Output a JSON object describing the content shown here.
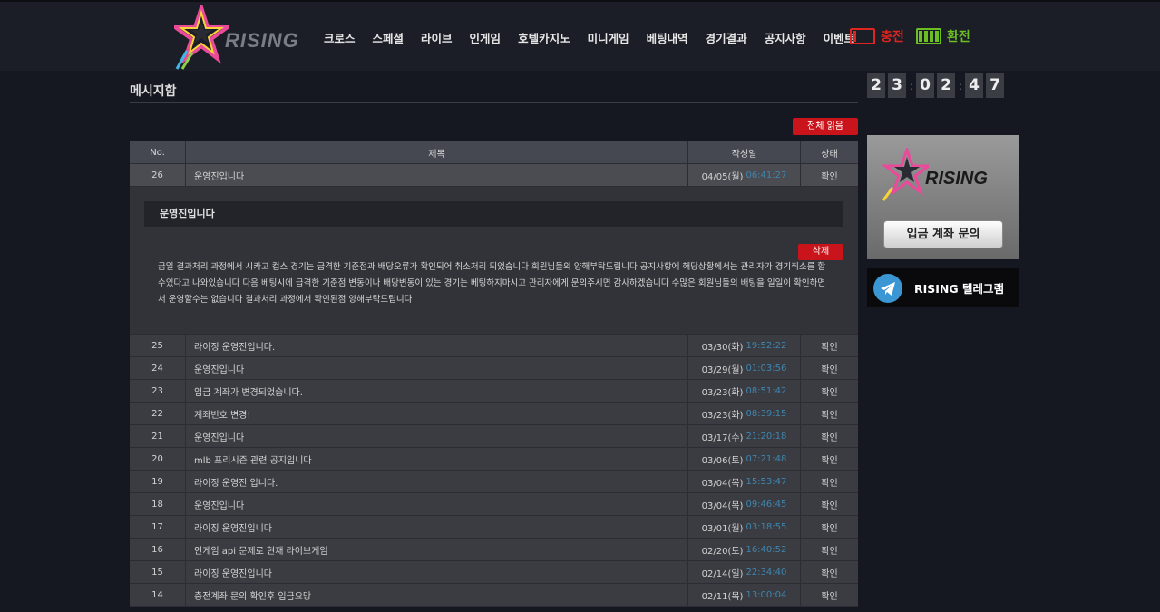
{
  "header": {
    "logo_text": "RISING",
    "nav": [
      "크로스",
      "스페셜",
      "라이브",
      "인게임",
      "호텔카지노",
      "미니게임",
      "베팅내역",
      "경기결과",
      "공지사항",
      "이벤트"
    ],
    "charge_label": "충전",
    "exchange_label": "환전",
    "colors": {
      "charge": "#e0241f",
      "exchange": "#6cbf22"
    }
  },
  "page": {
    "title": "메시지함",
    "read_all_label": "전체 읽음"
  },
  "table": {
    "headers": {
      "no": "No.",
      "title": "제목",
      "date": "작성일",
      "state": "상태"
    },
    "opened": {
      "no": "26",
      "title": "운영진입니다",
      "date": "04/05(월)",
      "time": "06:41:27",
      "state": "확인",
      "detail_title": "운영진입니다",
      "delete_label": "삭제",
      "body": "금일 결과처리 과정에서 시카고 컵스 경기는 급격한 기준점과 배당오류가 확인되어 취소처리 되었습니다 회원님들의 양해부탁드립니다 공지사항에 해당상황에서는 관리자가 경기취소를 할수있다고 나와있습니다 다음 베팅시에 급격한 기준점 변동이나 배당변동이 있는 경기는 베팅하지마시고 관리자에게 문의주시면 감사하겠습니다 수많은 회원님들의 배팅을 일일이 확인하면서 운영할수는 없습니다 결과처리 과정에서 확인된점 양해부탁드립니다"
    },
    "rows": [
      {
        "no": "25",
        "title": "라이징 운영진입니다.",
        "date": "03/30(화)",
        "time": "19:52:22",
        "state": "확인"
      },
      {
        "no": "24",
        "title": "운영진입니다",
        "date": "03/29(월)",
        "time": "01:03:56",
        "state": "확인"
      },
      {
        "no": "23",
        "title": "입금 계좌가 변경되었습니다.",
        "date": "03/23(화)",
        "time": "08:51:42",
        "state": "확인"
      },
      {
        "no": "22",
        "title": "계좌번호 변경!",
        "date": "03/23(화)",
        "time": "08:39:15",
        "state": "확인"
      },
      {
        "no": "21",
        "title": "운영진입니다",
        "date": "03/17(수)",
        "time": "21:20:18",
        "state": "확인"
      },
      {
        "no": "20",
        "title": "mlb 프리시즌 관련 공지입니다",
        "date": "03/06(토)",
        "time": "07:21:48",
        "state": "확인"
      },
      {
        "no": "19",
        "title": "라이징 운영진 입니다.",
        "date": "03/04(목)",
        "time": "15:53:47",
        "state": "확인"
      },
      {
        "no": "18",
        "title": "운영진입니다",
        "date": "03/04(목)",
        "time": "09:46:45",
        "state": "확인"
      },
      {
        "no": "17",
        "title": "라이징 운영진입니다",
        "date": "03/01(월)",
        "time": "03:18:55",
        "state": "확인"
      },
      {
        "no": "16",
        "title": "인게임 api 문제로 현재 라이브게임",
        "date": "02/20(토)",
        "time": "16:40:52",
        "state": "확인"
      },
      {
        "no": "15",
        "title": "라이징 운영진입니다",
        "date": "02/14(일)",
        "time": "22:34:40",
        "state": "확인"
      },
      {
        "no": "14",
        "title": "충전계좌 문의 확인후 입금요망",
        "date": "02/11(목)",
        "time": "13:00:04",
        "state": "확인"
      }
    ]
  },
  "sidebar": {
    "clock": [
      "2",
      "3",
      "0",
      "2",
      "4",
      "7"
    ],
    "promo_logo_text": "RISING",
    "deposit_label": "입금 계좌 문의",
    "telegram_label": "RISING 텔레그램"
  }
}
